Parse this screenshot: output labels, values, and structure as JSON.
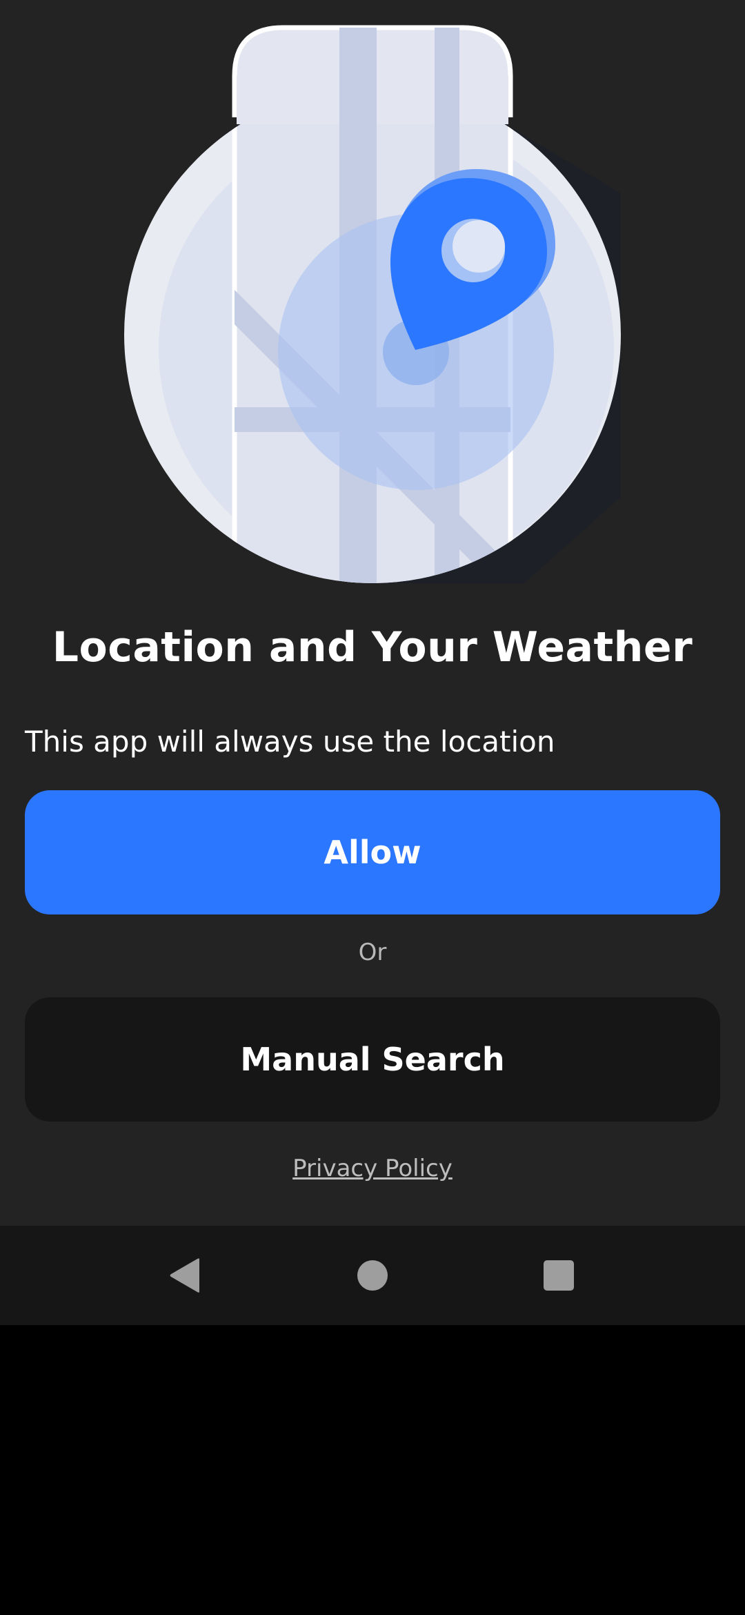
{
  "onboarding": {
    "illustration_icon": "location-pin-on-map",
    "title": "Location and Your Weather",
    "description": "This app will always use the location",
    "allow_label": "Allow",
    "or_label": "Or",
    "manual_search_label": "Manual Search",
    "privacy_policy_label": "Privacy Policy"
  },
  "navigation_bar": {
    "back_icon": "back-triangle-icon",
    "home_icon": "home-circle-icon",
    "recents_icon": "recents-square-icon"
  },
  "colors": {
    "background": "#232323",
    "accent": "#2b77ff",
    "secondary_button": "#161616",
    "nav_bar": "#161616"
  }
}
